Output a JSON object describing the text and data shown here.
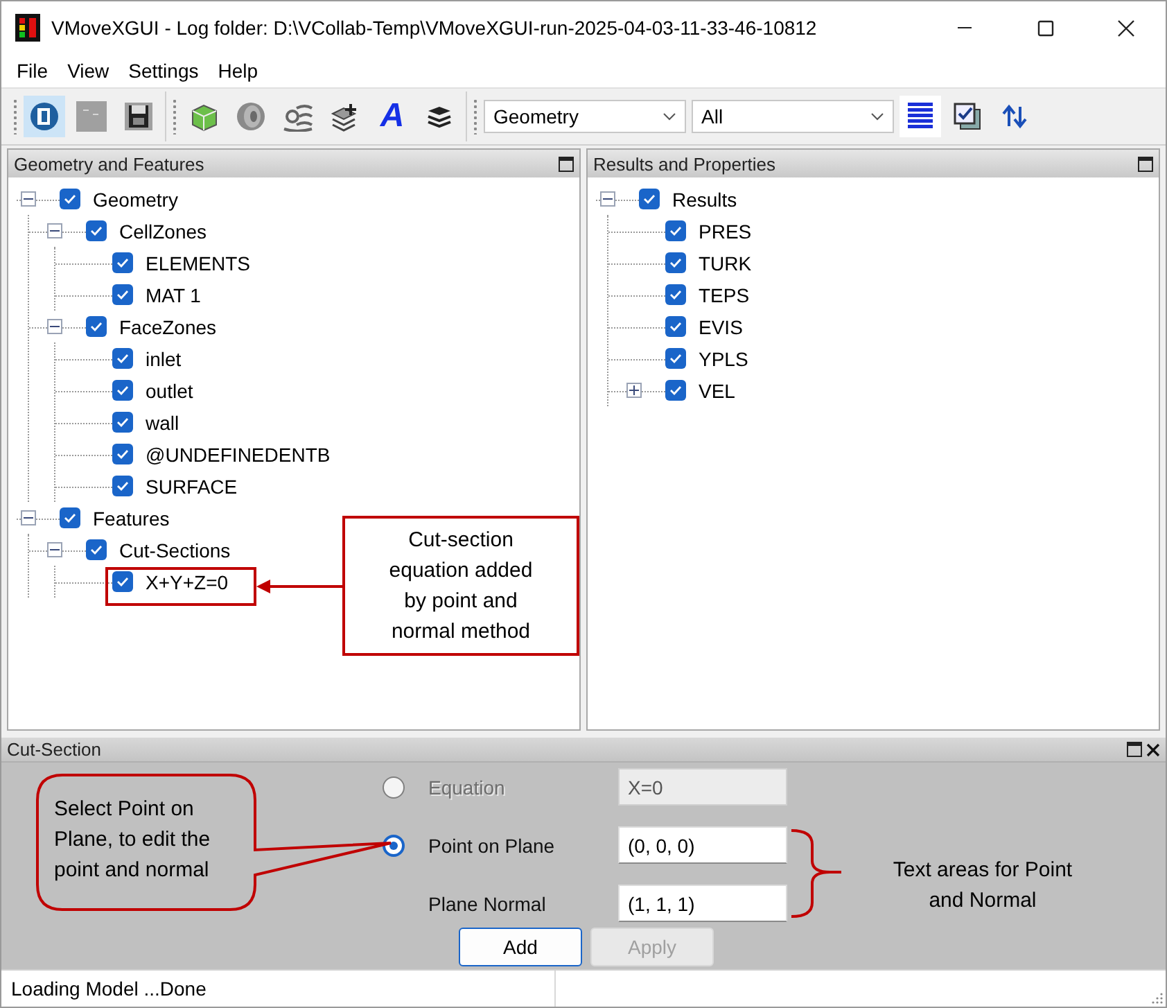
{
  "window": {
    "title": "VMoveXGUI - Log folder: D:\\VCollab-Temp\\VMoveXGUI-run-2025-04-03-11-33-46-10812"
  },
  "menu": [
    "File",
    "View",
    "Settings",
    "Help"
  ],
  "toolbar": {
    "groups": [
      [
        {
          "kind": "open",
          "pressed": true
        },
        {
          "kind": "ff",
          "disabled": true
        },
        {
          "kind": "save"
        }
      ],
      [
        {
          "kind": "cube"
        },
        {
          "kind": "disc"
        },
        {
          "kind": "waves"
        },
        {
          "kind": "layers-plus"
        },
        {
          "kind": "text-style",
          "label": "A"
        },
        {
          "kind": "stack"
        }
      ],
      [
        {
          "kind": "combo",
          "value": "Geometry"
        },
        {
          "kind": "combo",
          "value": "All"
        },
        {
          "kind": "lines",
          "pressed": true
        },
        {
          "kind": "checks"
        },
        {
          "kind": "swap"
        }
      ]
    ]
  },
  "panels": [
    {
      "title": "Geometry and Features",
      "tree": [
        {
          "label": "Geometry",
          "checked": true,
          "expanded": true,
          "children": [
            {
              "label": "CellZones",
              "checked": true,
              "expanded": true,
              "children": [
                {
                  "label": "ELEMENTS",
                  "checked": true
                },
                {
                  "label": "MAT 1",
                  "checked": true
                }
              ]
            },
            {
              "label": "FaceZones",
              "checked": true,
              "expanded": true,
              "children": [
                {
                  "label": "inlet",
                  "checked": true
                },
                {
                  "label": "outlet",
                  "checked": true
                },
                {
                  "label": "wall",
                  "checked": true
                },
                {
                  "label": "@UNDEFINEDENTB",
                  "checked": true
                },
                {
                  "label": "SURFACE",
                  "checked": true
                }
              ]
            }
          ]
        },
        {
          "label": "Features",
          "checked": true,
          "expanded": true,
          "children": [
            {
              "label": "Cut-Sections",
              "checked": true,
              "expanded": true,
              "children": [
                {
                  "label": "X+Y+Z=0",
                  "checked": true
                }
              ]
            }
          ]
        }
      ]
    },
    {
      "title": "Results and Properties",
      "tree": [
        {
          "label": "Results",
          "checked": true,
          "expanded": true,
          "children": [
            {
              "label": "PRES",
              "checked": true
            },
            {
              "label": "TURK",
              "checked": true
            },
            {
              "label": "TEPS",
              "checked": true
            },
            {
              "label": "EVIS",
              "checked": true
            },
            {
              "label": "YPLS",
              "checked": true
            },
            {
              "label": "VEL",
              "checked": true,
              "expanded": false
            }
          ]
        }
      ]
    }
  ],
  "cut_section": {
    "title": "Cut-Section",
    "rows": [
      {
        "kind": "radio",
        "label": "Equation",
        "selected": false,
        "disabled": true,
        "value": "X=0"
      },
      {
        "kind": "radio",
        "label": "Point on Plane",
        "selected": true,
        "disabled": false,
        "value": "(0, 0, 0)"
      },
      {
        "kind": "field",
        "label": "Plane Normal",
        "disabled": false,
        "value": "(1, 1, 1)"
      }
    ],
    "buttons": [
      {
        "label": "Add",
        "disabled": false
      },
      {
        "label": "Apply",
        "disabled": true
      }
    ]
  },
  "status_bar": {
    "text": "Loading Model ...Done"
  },
  "annotations": [
    {
      "kind": "box-arrow",
      "text": "Cut-section equation added by point and normal method"
    },
    {
      "kind": "bubble",
      "text": "Select Point on Plane, to edit the point and normal"
    },
    {
      "kind": "brace",
      "text": "Text areas for Point and Normal"
    }
  ]
}
